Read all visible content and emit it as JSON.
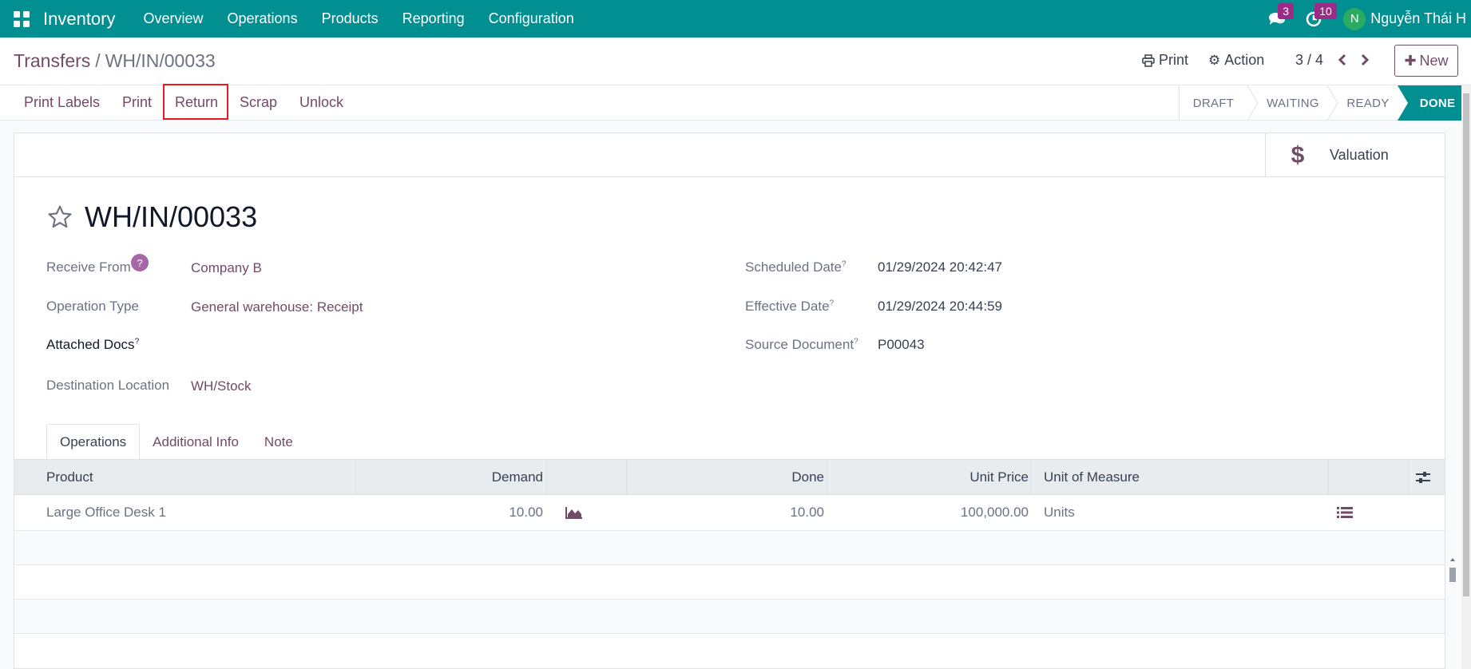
{
  "navbar": {
    "app": "Inventory",
    "menu": [
      "Overview",
      "Operations",
      "Products",
      "Reporting",
      "Configuration"
    ],
    "messages_count": "3",
    "activities_count": "10",
    "avatar_letter": "N",
    "user": "Nguyễn Thái H"
  },
  "control_panel": {
    "breadcrumb_parent": "Transfers",
    "breadcrumb_sep": "/",
    "breadcrumb_current": "WH/IN/00033",
    "print": "Print",
    "action": "Action",
    "pager": "3 / 4",
    "new": "New"
  },
  "header_buttons": {
    "print_labels": "Print Labels",
    "print": "Print",
    "return": "Return",
    "scrap": "Scrap",
    "unlock": "Unlock"
  },
  "stages": {
    "draft": "DRAFT",
    "waiting": "WAITING",
    "ready": "READY",
    "done": "DONE",
    "current": "DONE"
  },
  "smart_button": {
    "valuation": "Valuation"
  },
  "record": {
    "name": "WH/IN/00033",
    "receive_from_label": "Receive From",
    "receive_from": "Company B",
    "operation_type_label": "Operation Type",
    "operation_type": "General warehouse: Receipt",
    "attached_docs_label": "Attached Docs",
    "destination_label": "Destination Location",
    "destination": "WH/Stock",
    "scheduled_date_label": "Scheduled Date",
    "scheduled_date": "01/29/2024 20:42:47",
    "effective_date_label": "Effective Date",
    "effective_date": "01/29/2024 20:44:59",
    "source_document_label": "Source Document",
    "source_document": "P00043",
    "help_mark": "?",
    "tooltip_mark": "?"
  },
  "tabs": [
    "Operations",
    "Additional Info",
    "Note"
  ],
  "table": {
    "headers": {
      "product": "Product",
      "demand": "Demand",
      "done": "Done",
      "unit_price": "Unit Price",
      "uom": "Unit of Measure"
    },
    "rows": [
      {
        "product": "Large Office Desk 1",
        "demand": "10.00",
        "done": "10.00",
        "unit_price": "100,000.00",
        "uom": "Units"
      }
    ]
  },
  "colors": {
    "navbar": "#018f91",
    "brand": "#714b67",
    "highlight": "#e11d24",
    "badge": "#9c2a86"
  }
}
